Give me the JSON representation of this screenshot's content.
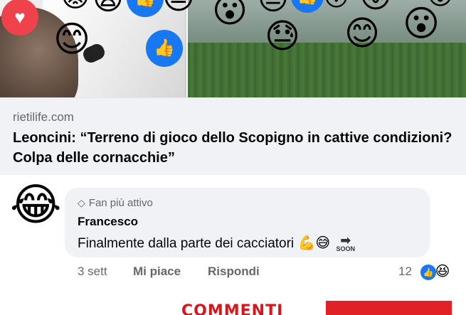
{
  "post": {
    "preview": {
      "domain": "rietilife.com",
      "headline": "Leoncini: “Terreno di gioco dello Scopigno in cattive condizioni? Colpa delle cornacchie”"
    },
    "reaction_emojis": [
      "😊",
      "😟",
      "😫",
      "😔",
      "😮",
      "😑",
      "😓",
      "😊",
      "😖",
      "😮",
      "😯",
      "😮"
    ],
    "icons": {
      "heart": "heart-icon",
      "like": "thumbs-up-icon"
    }
  },
  "comment": {
    "avatar_emoji": "😂",
    "badge": "Fan più attivo",
    "author": "Francesco",
    "text": "Finalmente dalla parte dei cacciatori",
    "text_emojis": [
      "💪",
      "😅"
    ],
    "soon_label": "SOON",
    "time": "3 sett",
    "like_label": "Mi piace",
    "reply_label": "Rispondi",
    "reaction_count": "12",
    "reaction_haha": "😆"
  },
  "banner": {
    "text": "COMMENTI"
  },
  "colors": {
    "accent": "#1877f2",
    "heart": "#f0424b",
    "banner_red": "#e02226",
    "bubble_bg": "#f0f2f5",
    "muted": "#65676b"
  }
}
